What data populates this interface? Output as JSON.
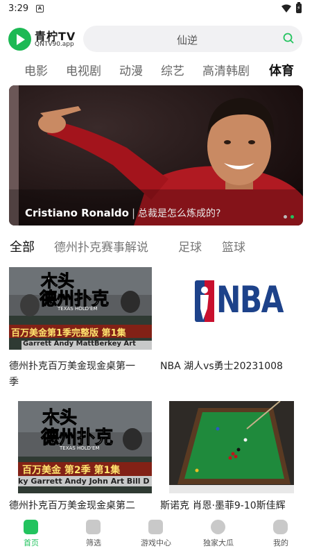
{
  "status_bar": {
    "time": "3:29",
    "notification_icon": "A"
  },
  "header": {
    "app_name": "青柠TV",
    "app_domain": "QNTV90.app",
    "search_placeholder": "仙逆"
  },
  "categories": [
    "电影",
    "电视剧",
    "动漫",
    "综艺",
    "高清韩剧",
    "体育"
  ],
  "active_category": "体育",
  "banner": {
    "name": "Cristiano Ronaldo",
    "separator": "|",
    "subtitle": "总裁是怎么炼成的?",
    "active_dot": 2,
    "dot_count": 2
  },
  "sub_tabs": [
    "全部",
    "德州扑克赛事解说",
    "足球",
    "篮球"
  ],
  "active_sub_tab": "全部",
  "videos": [
    {
      "title_line1": "德州扑克百万美金现金桌第一",
      "title_line2": "季",
      "thumb": "poker-thumbnail",
      "thumb_text": {
        "brand": "木头",
        "game": "德州扑克",
        "tag": "TEXAS HOLD'EM",
        "caption": "百万美金第1季完整版 第1集",
        "players": "Garrett  Andy  MattBerkey  Art"
      }
    },
    {
      "title_line1": "NBA 湖人vs勇士20231008",
      "thumb": "nba-logo",
      "thumb_text": {
        "logo": "NBA"
      }
    },
    {
      "title_line1": "德州扑克百万美金现金桌第二",
      "thumb": "poker-thumbnail",
      "thumb_text": {
        "brand": "木头",
        "game": "德州扑克",
        "tag": "TEXAS HOLD'EM",
        "caption": "百万美金  第2季  第1集",
        "players": "ky Garrett Andy John Art Bill D"
      }
    },
    {
      "title_line1": "斯诺克 肖恩·墨菲9-10斯佳辉",
      "thumb": "snooker-table"
    }
  ],
  "bottom_nav": [
    {
      "label": "首页",
      "icon": "home-icon",
      "active": true
    },
    {
      "label": "筛选",
      "icon": "filter-icon",
      "active": false
    },
    {
      "label": "游戏中心",
      "icon": "game-icon",
      "active": false
    },
    {
      "label": "独家大瓜",
      "icon": "melon-icon",
      "active": false
    },
    {
      "label": "我的",
      "icon": "profile-icon",
      "active": false
    }
  ],
  "colors": {
    "accent": "#22c35e",
    "brand": "#1db954"
  }
}
